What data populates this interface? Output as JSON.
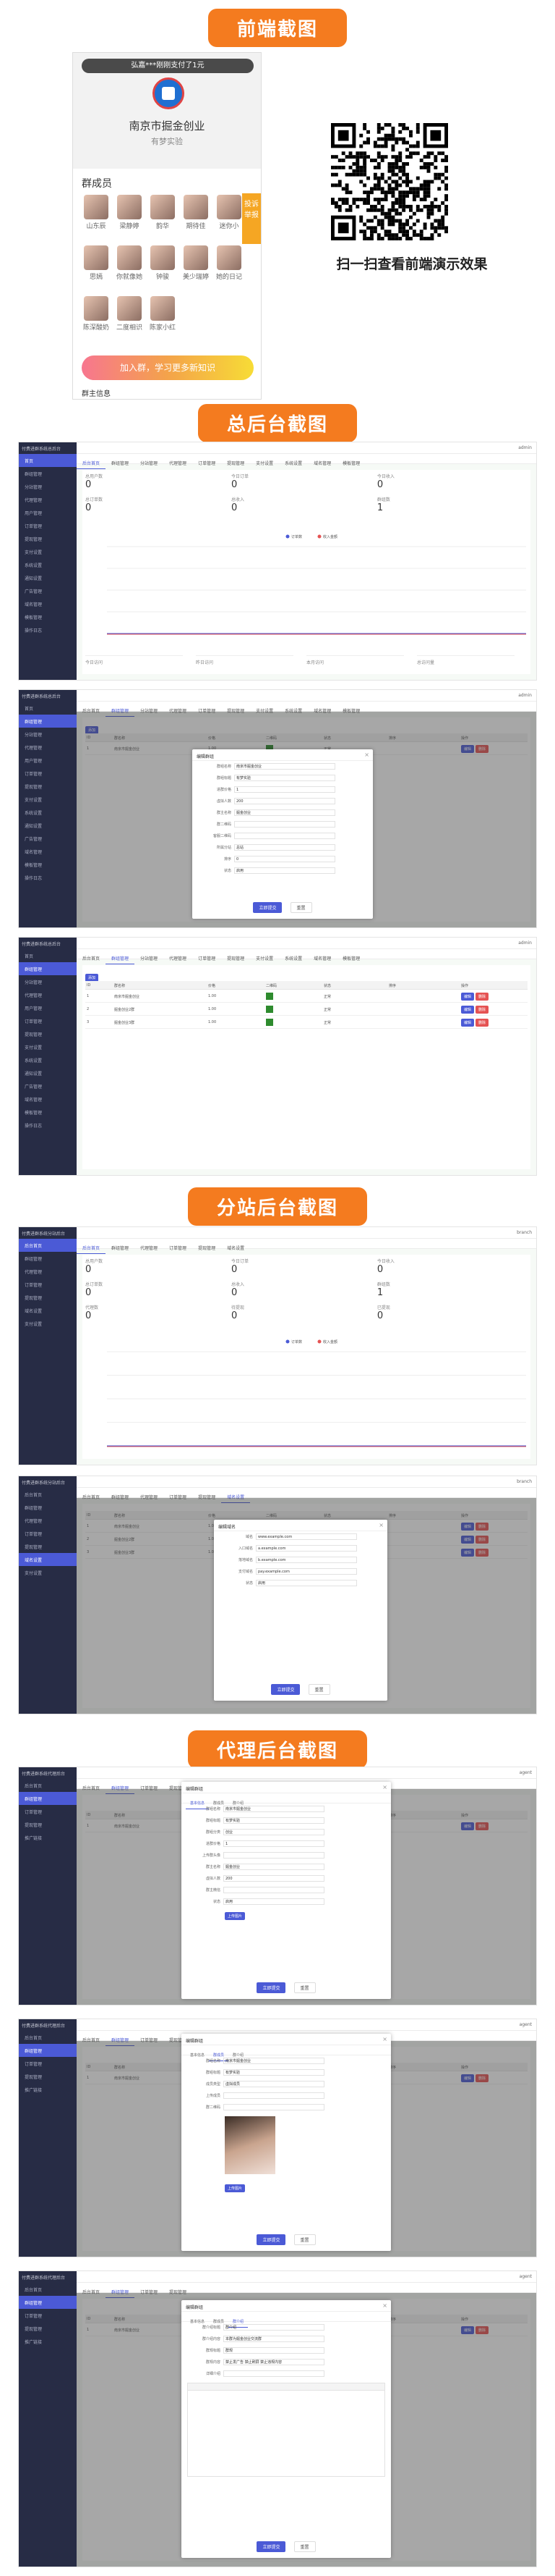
{
  "sections": {
    "frontend": "前端截图",
    "admin": "总后台截图",
    "branch": "分站后台截图",
    "agent": "代理后台截图"
  },
  "phone": {
    "banner": "弘嘉***刚刚支付了1元",
    "org_name": "南京市掘金创业",
    "org_sub": "有梦实验",
    "members_title": "群成员",
    "side_tag": "投诉 举报",
    "members": [
      "山东辰",
      "梁静婷",
      "韵华",
      "期待佳",
      "迷你小",
      "思嫣",
      "你就像她",
      "钟骏",
      "美少瑞婷",
      "她的日记",
      "陈深酸奶",
      "二度相识",
      "陈家小红"
    ],
    "join_button": "加入群，学习更多新知识",
    "bottom_note": "群主信息"
  },
  "qr_caption": "扫一扫查看前端演示效果",
  "admin_shell": {
    "brand": "付费进群系统总后台",
    "user": "admin",
    "nav": [
      "首页",
      "群组管理",
      "分站管理",
      "代理管理",
      "用户管理",
      "订单管理",
      "提现管理",
      "支付设置",
      "系统设置",
      "通知设置",
      "广告管理",
      "域名管理",
      "模板管理",
      "操作日志"
    ],
    "tabs": [
      "后台首页",
      "群组管理",
      "分站管理",
      "代理管理",
      "订单管理",
      "提现管理",
      "支付设置",
      "系统设置",
      "域名管理",
      "模板管理"
    ]
  },
  "dashboard": {
    "stats": [
      {
        "label": "总用户数",
        "value": "0"
      },
      {
        "label": "今日订单",
        "value": "0"
      },
      {
        "label": "今日收入",
        "value": "0"
      },
      {
        "label": "总订单数",
        "value": "0"
      },
      {
        "label": "总收入",
        "value": "0"
      },
      {
        "label": "群组数",
        "value": "1"
      }
    ],
    "legend": [
      "订单数",
      "收入金额"
    ],
    "bottom_cards": [
      "今日访问",
      "昨日访问",
      "本月访问",
      "总访问量"
    ]
  },
  "group_edit": {
    "title": "编辑群组",
    "fields": [
      {
        "label": "群组名称",
        "value": "南京市掘金创业"
      },
      {
        "label": "群组标题",
        "value": "有梦实验"
      },
      {
        "label": "进群价格",
        "value": "1"
      },
      {
        "label": "虚拟人数",
        "value": "200"
      },
      {
        "label": "群主名称",
        "value": "掘金创业"
      },
      {
        "label": "群二维码",
        "value": ""
      },
      {
        "label": "客服二维码",
        "value": ""
      },
      {
        "label": "所属分站",
        "value": "总站"
      },
      {
        "label": "排序",
        "value": "0"
      },
      {
        "label": "状态",
        "value": "启用"
      }
    ],
    "confirm": "立即提交",
    "cancel": "重置"
  },
  "group_list": {
    "add": "添加",
    "headers": [
      "ID",
      "群名称",
      "价格",
      "二维码",
      "状态",
      "排序",
      "操作"
    ],
    "rows": [
      {
        "id": "1",
        "name": "南京市掘金创业",
        "price": "1.00",
        "status": "正常"
      },
      {
        "id": "2",
        "name": "掘金创业2群",
        "price": "1.00",
        "status": "正常"
      },
      {
        "id": "3",
        "name": "掘金创业3群",
        "price": "1.00",
        "status": "正常"
      }
    ],
    "edit": "编辑",
    "delete": "删除"
  },
  "branch_shell": {
    "brand": "付费进群系统分站后台",
    "user": "branch",
    "nav": [
      "后台首页",
      "群组管理",
      "代理管理",
      "订单管理",
      "提现管理",
      "域名设置",
      "支付设置"
    ],
    "tabs": [
      "后台首页",
      "群组管理",
      "代理管理",
      "订单管理",
      "提现管理",
      "域名设置"
    ]
  },
  "branch_dashboard": {
    "stats": [
      {
        "label": "总用户数",
        "value": "0"
      },
      {
        "label": "今日订单",
        "value": "0"
      },
      {
        "label": "今日收入",
        "value": "0"
      },
      {
        "label": "总订单数",
        "value": "0"
      },
      {
        "label": "总收入",
        "value": "0"
      },
      {
        "label": "群组数",
        "value": "1"
      },
      {
        "label": "代理数",
        "value": "0"
      },
      {
        "label": "待提现",
        "value": "0"
      },
      {
        "label": "已提现",
        "value": "0"
      }
    ],
    "legend": [
      "订单数",
      "收入金额"
    ]
  },
  "branch_edit": {
    "title": "编辑域名",
    "fields": [
      {
        "label": "域名",
        "value": "www.example.com"
      },
      {
        "label": "入口域名",
        "value": "a.example.com"
      },
      {
        "label": "落地域名",
        "value": "b.example.com"
      },
      {
        "label": "支付域名",
        "value": "pay.example.com"
      },
      {
        "label": "状态",
        "value": "启用"
      }
    ],
    "confirm": "立即提交",
    "cancel": "重置"
  },
  "agent_shell": {
    "brand": "付费进群系统代理后台",
    "user": "agent",
    "nav": [
      "后台首页",
      "群组管理",
      "订单管理",
      "提现管理",
      "推广链接"
    ],
    "tabs": [
      "后台首页",
      "群组管理",
      "订单管理",
      "提现管理"
    ]
  },
  "agent_tabs": [
    "基本信息",
    "群成员",
    "群介绍"
  ],
  "agent_edit_1": {
    "title": "编辑群组",
    "fields": [
      {
        "label": "群组名称",
        "value": "南京市掘金创业"
      },
      {
        "label": "群组标题",
        "value": "有梦实验"
      },
      {
        "label": "群组分类",
        "value": "创业"
      },
      {
        "label": "进群价格",
        "value": "1"
      },
      {
        "label": "上传群头像",
        "value": ""
      },
      {
        "label": "群主名称",
        "value": "掘金创业"
      },
      {
        "label": "虚拟人数",
        "value": "200"
      },
      {
        "label": "群主微信",
        "value": ""
      },
      {
        "label": "状态",
        "value": "启用"
      }
    ],
    "upload": "上传图片",
    "confirm": "立即提交",
    "cancel": "重置"
  },
  "agent_edit_2": {
    "title": "编辑群组",
    "fields": [
      {
        "label": "群组名称",
        "value": "南京市掘金创业"
      },
      {
        "label": "群组标题",
        "value": "有梦实验"
      },
      {
        "label": "成员类型",
        "value": "虚拟成员"
      },
      {
        "label": "上传成员",
        "value": ""
      },
      {
        "label": "群二维码",
        "value": ""
      }
    ],
    "upload": "上传图片",
    "confirm": "立即提交",
    "cancel": "重置"
  },
  "agent_edit_3": {
    "title": "编辑群组",
    "fields": [
      {
        "label": "群介绍标题",
        "value": "群介绍"
      },
      {
        "label": "群介绍内容",
        "value": "本群为掘金创业交流群"
      },
      {
        "label": "群规标题",
        "value": "群规"
      },
      {
        "label": "群规内容",
        "value": "禁止发广告 禁止刷屏 禁止违规内容"
      },
      {
        "label": "详细介绍",
        "value": ""
      }
    ],
    "confirm": "立即提交",
    "cancel": "重置"
  },
  "colors": {
    "accent": "#f47b1f",
    "sidebar": "#272c45",
    "primary": "#4b5ad6",
    "chart_orders": "#4b5ad6",
    "chart_income": "#e55353"
  }
}
